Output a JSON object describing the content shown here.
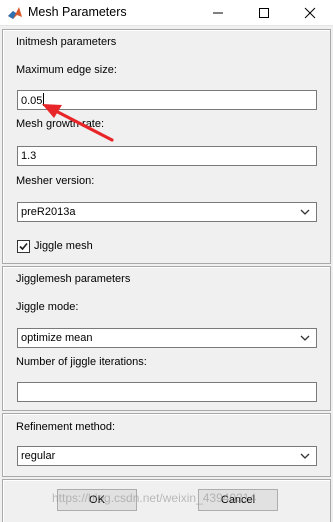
{
  "window": {
    "title": "Mesh Parameters",
    "app_icon": "matlab-icon",
    "controls": [
      "minimize-icon",
      "maximize-icon",
      "close-icon"
    ]
  },
  "initmesh": {
    "header": "Initmesh parameters",
    "max_edge_label": "Maximum edge size:",
    "max_edge_value": "0.05",
    "growth_label": "Mesh growth rate:",
    "growth_value": "1.3",
    "mesher_label": "Mesher version:",
    "mesher_value": "preR2013a",
    "jiggle_label": "Jiggle mesh",
    "jiggle_checked": true
  },
  "jigglemesh": {
    "header": "Jigglemesh parameters",
    "mode_label": "Jiggle mode:",
    "mode_value": "optimize mean",
    "iterations_label": "Number of jiggle iterations:",
    "iterations_value": ""
  },
  "refinement": {
    "label": "Refinement method:",
    "value": "regular"
  },
  "buttons": {
    "ok": "OK",
    "cancel": "Cancel"
  },
  "watermark": "https://blog.csdn.net/weixin_43940314",
  "colors": {
    "annotation_arrow": "#e8262a",
    "checkmark": "#222222"
  }
}
